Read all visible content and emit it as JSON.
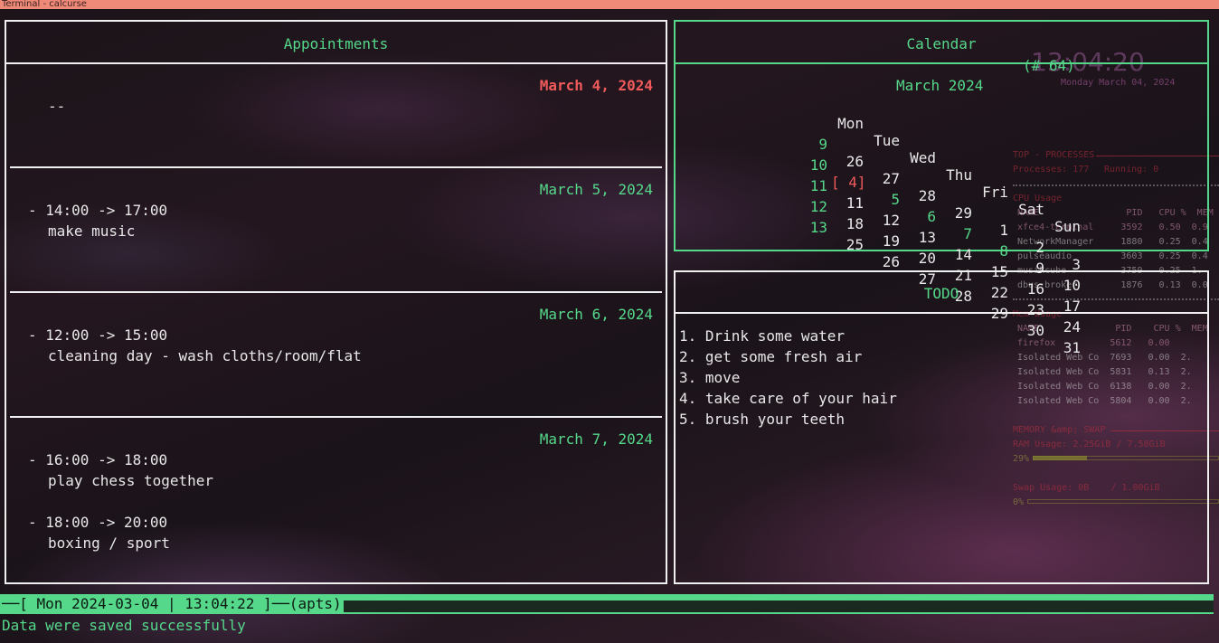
{
  "window": {
    "title": "Terminal - calcurse"
  },
  "appointments": {
    "title": "Appointments",
    "days": [
      {
        "date": "March  4, 2024",
        "current": true,
        "entries": [
          {
            "text": "--"
          }
        ]
      },
      {
        "date": "March  5, 2024",
        "entries": [
          {
            "time": "- 14:00 -> 17:00",
            "desc": "make music"
          }
        ]
      },
      {
        "date": "March  6, 2024",
        "entries": [
          {
            "time": "- 12:00 -> 15:00",
            "desc": "cleaning day - wash cloths/room/flat"
          }
        ]
      },
      {
        "date": "March  7, 2024",
        "entries": [
          {
            "time": "- 16:00 -> 18:00",
            "desc": "play chess together"
          },
          {
            "time": "- 18:00 -> 20:00",
            "desc": "boxing / sport"
          }
        ]
      }
    ]
  },
  "calendar": {
    "title": "Calendar",
    "week_label": "(# 64)",
    "month": "March 2024",
    "weekdays": [
      "Mon",
      "Tue",
      "Wed",
      "Thu",
      "Fri",
      "Sat",
      "Sun"
    ],
    "weeks": [
      {
        "wk": "9",
        "days": [
          "26",
          "27",
          "28",
          "29",
          "1",
          "2",
          "3"
        ]
      },
      {
        "wk": "10",
        "days": [
          "[ 4]",
          "5",
          "6",
          "7",
          "8",
          "9",
          "10"
        ]
      },
      {
        "wk": "11",
        "days": [
          "11",
          "12",
          "13",
          "14",
          "15",
          "16",
          "17"
        ]
      },
      {
        "wk": "12",
        "days": [
          "18",
          "19",
          "20",
          "21",
          "22",
          "23",
          "24"
        ]
      },
      {
        "wk": "13",
        "days": [
          "25",
          "26",
          "27",
          "28",
          "29",
          "30",
          "31"
        ]
      }
    ]
  },
  "todo": {
    "title": "TODO",
    "items": [
      "1. Drink some water",
      "2. get some fresh air",
      "3. move",
      "4. take care of your hair",
      "5. brush your teeth"
    ]
  },
  "statusbar": {
    "text": "[ Mon 2024-03-04 | 13:04:22 ]──(apts)"
  },
  "message": "Data were saved successfully",
  "conky": {
    "clock": "13:04:20",
    "date": "Monday March 04, 2024",
    "top_processes": "TOP - PROCESSES",
    "processes_label": "Processes: 177",
    "running_label": "Running: 0",
    "cpu_usage": "CPU Usage",
    "cpu_header": "NAME                PID   CPU %  MEM",
    "cpu_rows": [
      "xfce4-terminal     3592   0.50  0.9",
      "NetworkManager     1880   0.25  0.4",
      "pulseaudio         3603   0.25  0.4",
      "musikcube          3759   0.25  1.",
      "dbus-broker        1876   0.13  0.0"
    ],
    "mem_usage": "Mem Usage",
    "mem_header": "NAME              PID    CPU %  MEM",
    "mem_rows": [
      "firefox          5612   0.00",
      "Isolated Web Co  7693   0.00  2.",
      "Isolated Web Co  5831   0.13  2.",
      "Isolated Web Co  6138   0.00  2.",
      "Isolated Web Co  5804   0.00  2."
    ],
    "memory_swap": "MEMORY &amp; SWAP",
    "ram_usage": "RAM Usage: 2.25GiB / 7.58GiB",
    "ram_pct": "29%",
    "ram_fraction": 0.29,
    "swap_usage": "Swap Usage: 0B    / 1.00GiB",
    "swap_pct": "0%"
  }
}
